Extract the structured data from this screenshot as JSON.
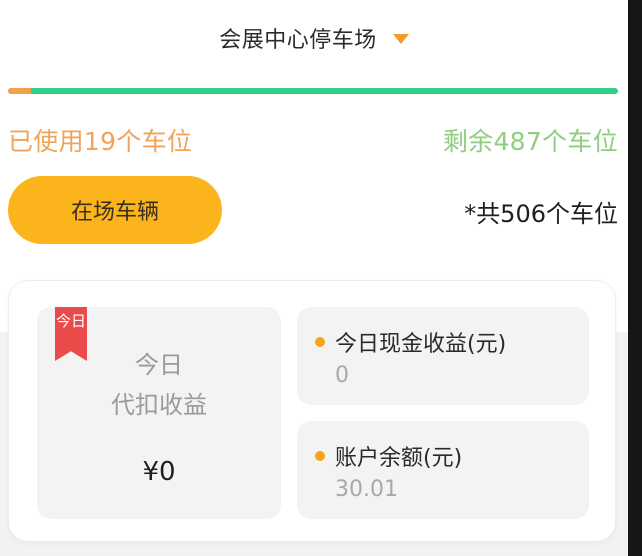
{
  "header": {
    "lot_name": "会展中心停车场",
    "dropdown_icon": "caret-down-icon"
  },
  "occupancy": {
    "used_fraction": 0.0375,
    "used_label": "已使用19个车位",
    "remaining_label": "剩余487个车位",
    "total_label": "*共506个车位",
    "colors": {
      "used": "#f3a04b",
      "remaining": "#2fcf87"
    }
  },
  "actions": {
    "vehicles_label": "在场车辆"
  },
  "earnings": {
    "ribbon_label": "今日",
    "deduction_title_line1": "今日",
    "deduction_title_line2": "代扣收益",
    "deduction_amount": "¥0",
    "cash_title": "今日现金收益(元)",
    "cash_value": "0",
    "balance_title": "账户余额(元)",
    "balance_value": "30.01"
  }
}
